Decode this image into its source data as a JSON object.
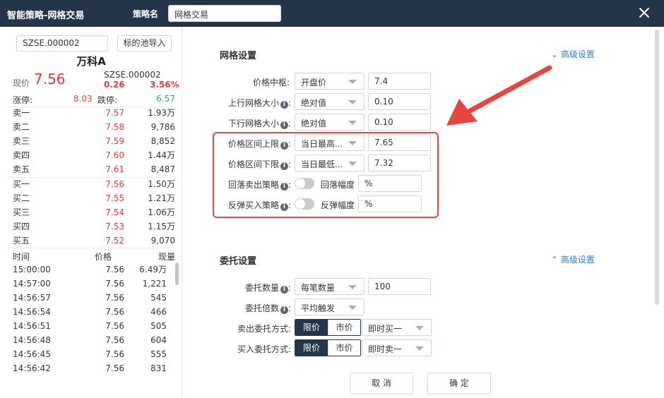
{
  "titlebar": {
    "app_title": "智能策略-网格交易",
    "name_label": "策略名",
    "name_value": "网格交易"
  },
  "left": {
    "code_input": "SZSE.000002",
    "pool_button": "标的池导入",
    "stock_name": "万科A",
    "price_label": "现价",
    "price": "7.56",
    "code": "SZSE.000002",
    "change": "0.26",
    "change_pct": "3.56%",
    "limit_up_label": "涨停:",
    "limit_up": "8.03",
    "limit_down_label": "跌停:",
    "limit_down": "6.57",
    "asks": [
      {
        "label": "卖一",
        "price": "7.57",
        "vol": "1.93万"
      },
      {
        "label": "卖二",
        "price": "7.58",
        "vol": "9,786"
      },
      {
        "label": "卖三",
        "price": "7.59",
        "vol": "8,852"
      },
      {
        "label": "卖四",
        "price": "7.60",
        "vol": "1.44万"
      },
      {
        "label": "卖五",
        "price": "7.61",
        "vol": "8,487"
      }
    ],
    "bids": [
      {
        "label": "买一",
        "price": "7.56",
        "vol": "1.50万"
      },
      {
        "label": "买二",
        "price": "7.55",
        "vol": "1.21万"
      },
      {
        "label": "买三",
        "price": "7.54",
        "vol": "1.06万"
      },
      {
        "label": "买四",
        "price": "7.53",
        "vol": "1.15万"
      },
      {
        "label": "买五",
        "price": "7.52",
        "vol": "9,070"
      }
    ],
    "tick_header": {
      "time": "时间",
      "price": "价格",
      "vol": "现量"
    },
    "ticks": [
      {
        "time": "15:00:00",
        "price": "7.56",
        "vol": "6.49万"
      },
      {
        "time": "14:57:00",
        "price": "7.56",
        "vol": "1,221"
      },
      {
        "time": "14:56:57",
        "price": "7.56",
        "vol": "545"
      },
      {
        "time": "14:56:54",
        "price": "7.56",
        "vol": "466"
      },
      {
        "time": "14:56:51",
        "price": "7.56",
        "vol": "505"
      },
      {
        "time": "14:56:48",
        "price": "7.56",
        "vol": "604"
      },
      {
        "time": "14:56:45",
        "price": "7.56",
        "vol": "555"
      },
      {
        "time": "14:56:42",
        "price": "7.56",
        "vol": "831"
      }
    ]
  },
  "grid": {
    "title": "网格设置",
    "advanced": "高级设置",
    "price_center_label": "价格中枢:",
    "price_center_type": "开盘价",
    "price_center_value": "7.4",
    "up_size_label": "上行网格大小",
    "up_size_type": "绝对值",
    "up_size_value": "0.10",
    "down_size_label": "下行网格大小",
    "down_size_type": "绝对值",
    "down_size_value": "0.10",
    "upper_label": "价格区间上限",
    "upper_type": "当日最高...",
    "upper_value": "7.65",
    "lower_label": "价格区间下限",
    "lower_type": "当日最低...",
    "lower_value": "7.32",
    "pullback_label": "回落卖出策略",
    "pullback_range_label": "回落幅度",
    "pullback_unit": "%",
    "rebound_label": "反弹买入策略",
    "rebound_range_label": "反弹幅度",
    "rebound_unit": "%",
    "colon": ":"
  },
  "order": {
    "title": "委托设置",
    "advanced": "高级设置",
    "qty_label": "委托数量",
    "qty_type": "每笔数量",
    "qty_value": "100",
    "mult_label": "委托倍数",
    "mult_type": "平均触发",
    "sell_label": "卖出委托方式:",
    "buy_label": "买入委托方式:",
    "limit": "限价",
    "market": "市价",
    "sell_mode": "即时买一",
    "buy_mode": "即时卖一"
  },
  "buttons": {
    "cancel": "取 消",
    "confirm": "确 定"
  },
  "colors": {
    "titlebar": "#243549",
    "up": "#e4393c",
    "down": "#2aa65b",
    "link": "#2e7bd6",
    "highlight": "#e8453c"
  }
}
